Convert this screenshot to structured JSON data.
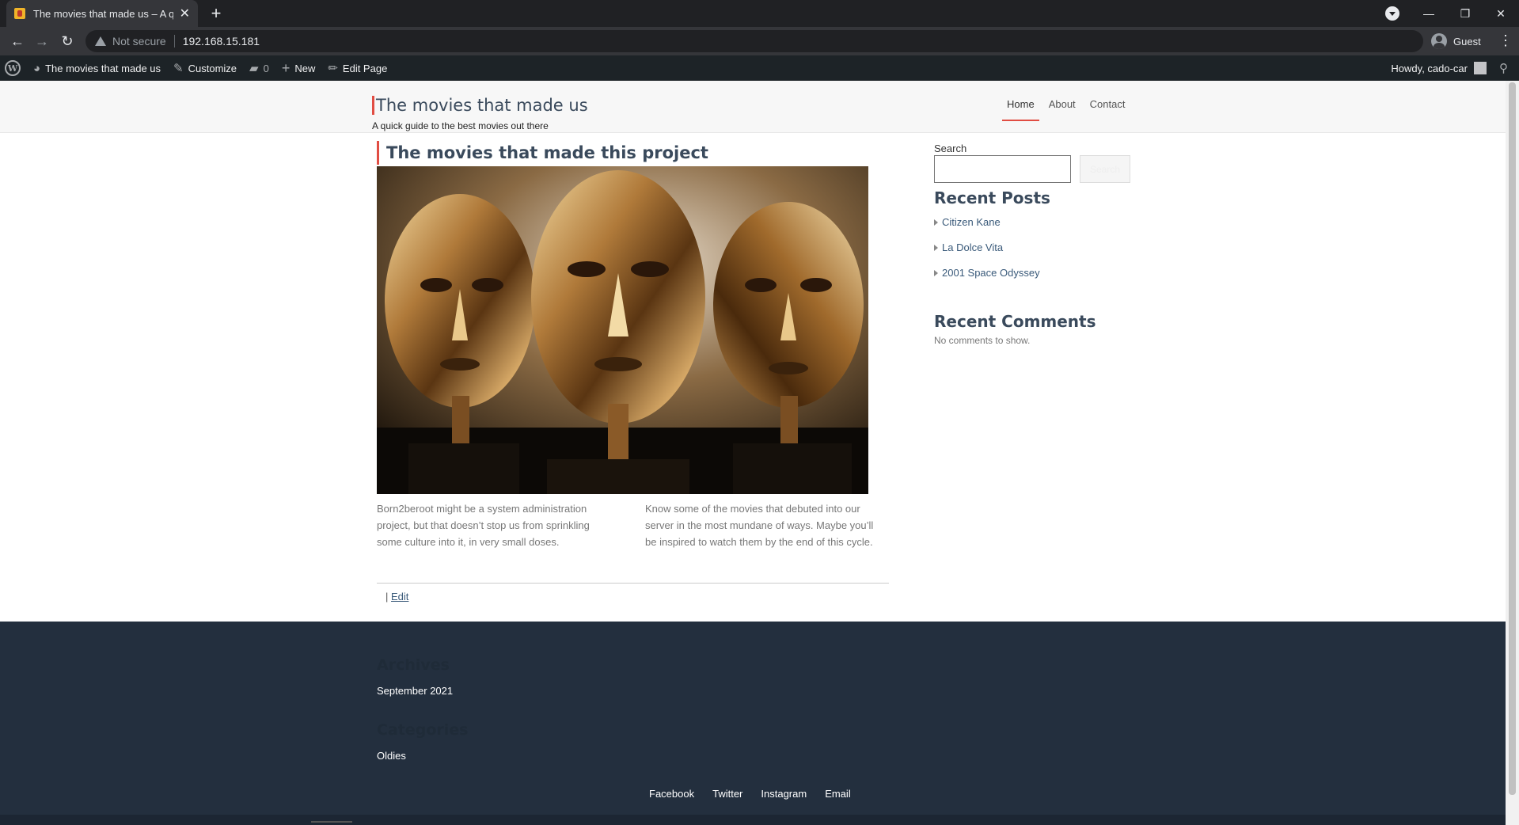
{
  "browser": {
    "tab_title": "The movies that made us – A quick guide to the best movies out there",
    "security_label": "Not secure",
    "url": "192.168.15.181",
    "profile_name": "Guest"
  },
  "admin_bar": {
    "site_name": "The movies that made us",
    "customize": "Customize",
    "comments_count": "0",
    "new": "New",
    "edit_page": "Edit Page",
    "howdy": "Howdy, cado-car"
  },
  "site": {
    "title": "The movies that made us",
    "description": "A quick guide to the best movies out there",
    "nav": [
      "Home",
      "About",
      "Contact"
    ]
  },
  "entry": {
    "title": "The movies that made this project",
    "col_left": "Born2beroot might be a system administration project, but that doesn’t stop us from sprinkling some culture into it, in very small doses.",
    "col_right": "Know some of the movies that debuted into our server in the most mundane of ways. Maybe you’ll be inspired to watch them by the end of this cycle.",
    "edit_sep": "|",
    "edit_label": "Edit"
  },
  "sidebar": {
    "search_label": "Search",
    "search_button": "Search",
    "recent_posts_title": "Recent Posts",
    "recent_posts": [
      "Citizen Kane",
      "La Dolce Vita",
      "2001 Space Odyssey"
    ],
    "recent_comments_title": "Recent Comments",
    "no_comments": "No comments to show."
  },
  "footer": {
    "archives_title": "Archives",
    "archives_item": "September 2021",
    "categories_title": "Categories",
    "categories_item": "Oldies",
    "social": [
      "Facebook",
      "Twitter",
      "Instagram",
      "Email"
    ]
  },
  "colors": {
    "accent": "#e14d43",
    "footer_bg": "#232f3e",
    "adminbar_bg": "#1d2327"
  }
}
